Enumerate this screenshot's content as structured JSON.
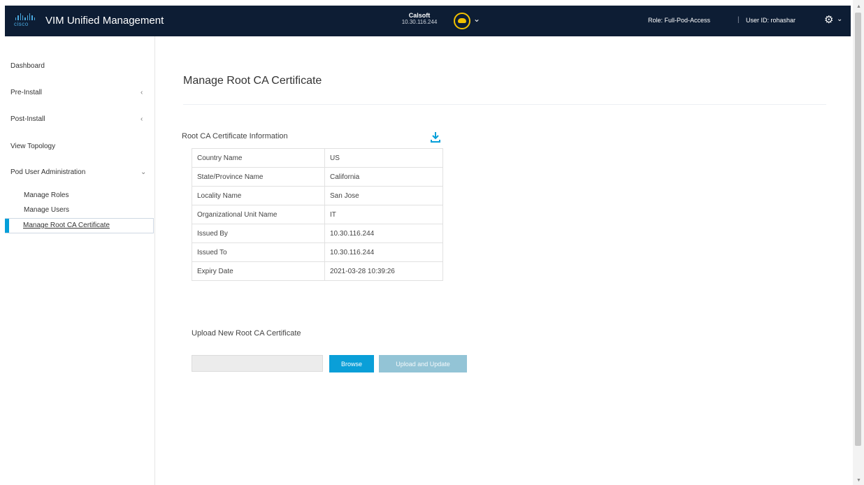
{
  "header": {
    "logo_text": "cisco",
    "app_title": "VIM Unified Management",
    "pod_name": "Calsoft",
    "pod_ip": "10.30.116.244",
    "role": "Role: Full-Pod-Access",
    "divider": "|",
    "user_id": "User ID: rohashar",
    "gear_icon": "⚙",
    "chevron": "⌄"
  },
  "sidebar": {
    "items": [
      {
        "label": "Dashboard"
      },
      {
        "label": "Pre-Install",
        "arrow": "‹"
      },
      {
        "label": "Post-Install",
        "arrow": "‹"
      },
      {
        "label": "View Topology"
      },
      {
        "label": "Pod User Administration",
        "arrow": "⌄"
      }
    ],
    "sub_items": [
      {
        "label": "Manage Roles"
      },
      {
        "label": "Manage Users"
      },
      {
        "label": "Manage Root CA Certificate",
        "active": true
      }
    ]
  },
  "main": {
    "page_title": "Manage Root CA Certificate",
    "info_title": "Root CA Certificate Information",
    "info_rows": [
      {
        "key": "Country Name",
        "value": "US"
      },
      {
        "key": "State/Province Name",
        "value": "California"
      },
      {
        "key": "Locality Name",
        "value": "San Jose"
      },
      {
        "key": "Organizational Unit Name",
        "value": "IT"
      },
      {
        "key": "Issued By",
        "value": "10.30.116.244"
      },
      {
        "key": "Issued To",
        "value": "10.30.116.244"
      },
      {
        "key": "Expiry Date",
        "value": "2021-03-28 10:39:26"
      }
    ],
    "upload_title": "Upload New Root CA Certificate",
    "browse_label": "Browse",
    "update_label": "Upload and Update"
  },
  "colors": {
    "header_bg": "#0d1d34",
    "accent": "#049fd9",
    "button_primary": "#0a9fd8",
    "button_disabled": "#93c4d6",
    "pod_icon": "#f2c100"
  }
}
